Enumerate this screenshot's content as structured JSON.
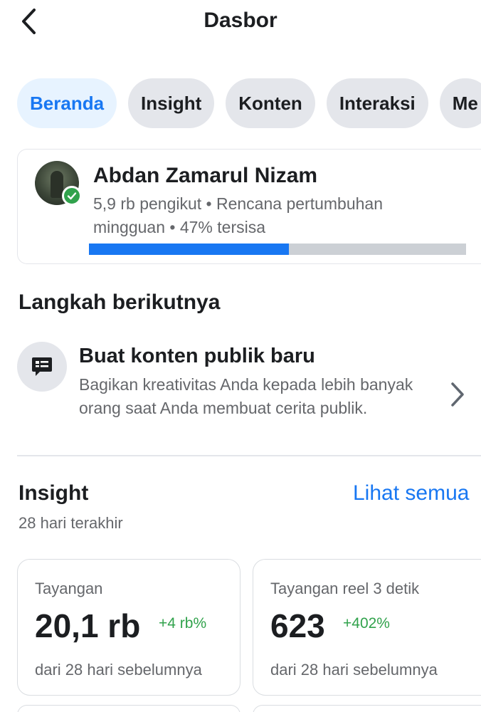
{
  "header": {
    "title": "Dasbor"
  },
  "tabs": [
    {
      "label": "Beranda",
      "active": true
    },
    {
      "label": "Insight"
    },
    {
      "label": "Konten"
    },
    {
      "label": "Interaksi"
    },
    {
      "label": "Me"
    }
  ],
  "profile": {
    "name": "Abdan Zamarul Nizam",
    "subtitle": "5,9 rb pengikut • Rencana pertumbuhan mingguan • 47% tersisa",
    "progress_fraction": 0.53
  },
  "next_steps": {
    "title": "Langkah berikutnya",
    "item": {
      "title": "Buat konten publik baru",
      "description": "Bagikan kreativitas Anda kepada lebih banyak orang saat Anda membuat cerita publik."
    }
  },
  "insight": {
    "title": "Insight",
    "see_all": "Lihat semua",
    "period": "28 hari terakhir",
    "cards": [
      {
        "label": "Tayangan",
        "value": "20,1 rb",
        "delta": "+4 rb%",
        "compare": "dari 28 hari sebelumnya"
      },
      {
        "label": "Tayangan reel 3 detik",
        "value": "623",
        "delta": "+402%",
        "compare": "dari 28 hari sebelumnya"
      }
    ]
  },
  "colors": {
    "accent": "#1877f2",
    "positive": "#31a24c",
    "muted": "#65676b",
    "chip": "#e4e6eb"
  }
}
